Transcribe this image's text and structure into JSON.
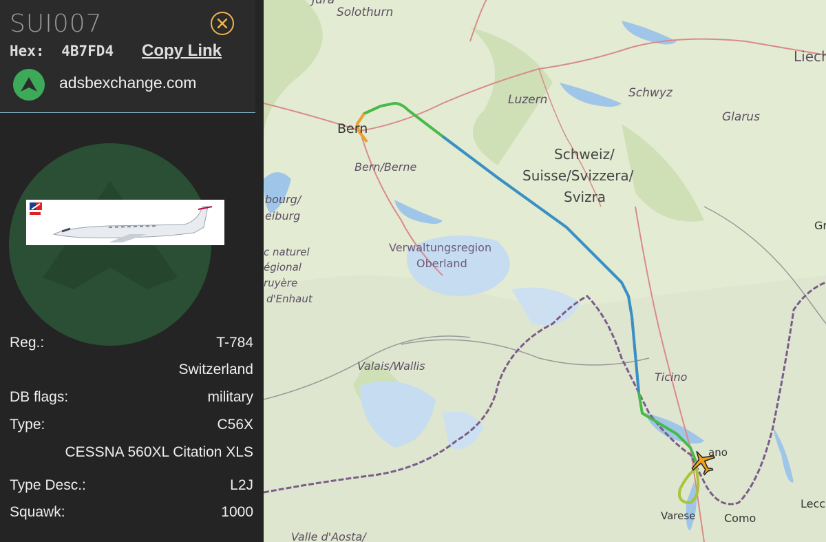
{
  "panel": {
    "callsign": "SUI007",
    "hex_label": "Hex:",
    "hex_value": "4B7FD4",
    "copy_link": "Copy Link",
    "source": "adsbexchange.com",
    "rows": [
      {
        "key": "Reg.:",
        "value": "T-784"
      },
      {
        "key": "",
        "value": "Switzerland"
      },
      {
        "key": "DB flags:",
        "value": "military"
      },
      {
        "key": "Type:",
        "value": "C56X"
      },
      {
        "key": "",
        "value": "CESSNA 560XL Citation XLS"
      },
      {
        "key": "Type Desc.:",
        "value": "L2J"
      },
      {
        "key": "Squawk:",
        "value": "1000"
      }
    ]
  },
  "map": {
    "labels": {
      "jura": "Jura",
      "solothurn": "Solothurn",
      "liech": "Liech",
      "luzern": "Luzern",
      "schwyz": "Schwyz",
      "glarus": "Glarus",
      "bern": "Bern",
      "bern_berne": "Bern/Berne",
      "schweiz": "Schweiz/",
      "suisse": "Suisse/Svizzera/",
      "svizra": "Svizra",
      "fribourg1": "bourg/",
      "fribourg2": "eiburg",
      "parc1": "c naturel",
      "parc2": "égional",
      "parc3": "ruyère",
      "parc4": "d'Enhaut",
      "verwaltung1": "Verwaltungsregion",
      "verwaltung2": "Oberland",
      "valais": "Valais/Wallis",
      "ticino": "Ticino",
      "lugano": "ano",
      "varese": "Varese",
      "como": "Como",
      "lecco": "Lecco",
      "gr": "Gr",
      "aosta": "Valle d'Aosta/"
    },
    "colors": {
      "track_orange": "#f0a030",
      "track_green": "#49b94a",
      "track_blue": "#3a8fc8",
      "aircraft": "#f0a020",
      "border": "#7a5c8a"
    }
  }
}
